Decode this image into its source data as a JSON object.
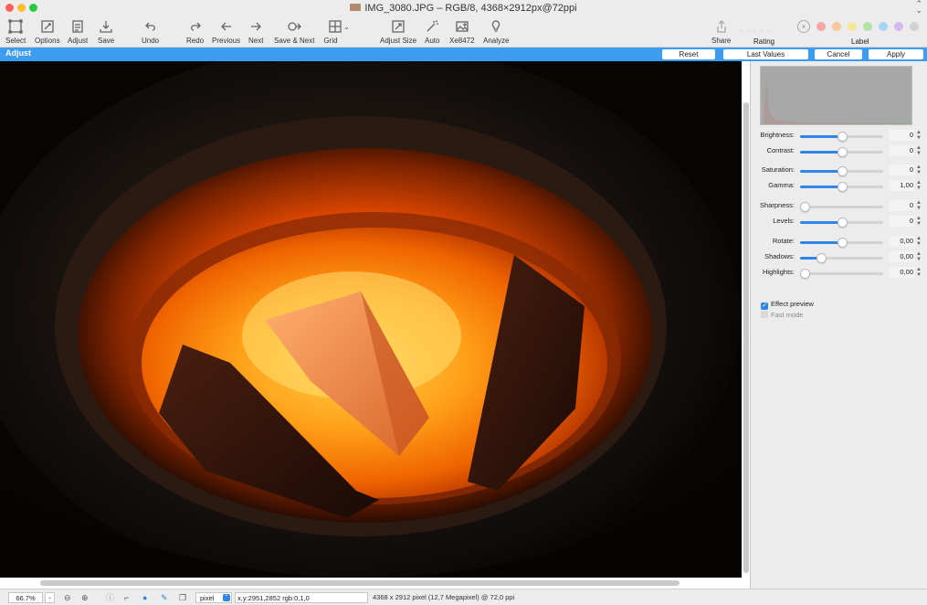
{
  "window": {
    "title": "IMG_3080.JPG – RGB/8, 4368×2912px@72ppi"
  },
  "toolbar": {
    "select": "Select",
    "options": "Options",
    "adjust": "Adjust",
    "save": "Save",
    "undo": "Undo",
    "redo": "Redo",
    "previous": "Previous",
    "next": "Next",
    "save_next": "Save & Next",
    "grid": "Grid",
    "adjust_size": "Adjust Size",
    "auto": "Auto",
    "xe": "Xe8472",
    "analyze": "Analyze",
    "share": "Share",
    "rating": "Rating",
    "label": "Label",
    "label_colors": [
      "#f7a6a6",
      "#f8c89c",
      "#f4e79a",
      "#b5e3a6",
      "#a8d4f5",
      "#d9b9f0",
      "#d2d2d2"
    ]
  },
  "adjust_bar": {
    "title": "Adjust",
    "reset": "Reset",
    "last_values": "Last Values",
    "cancel": "Cancel",
    "apply": "Apply"
  },
  "panel": {
    "sliders": [
      {
        "label": "Brightness:",
        "value": "0",
        "position": 0.5
      },
      {
        "label": "Contrast:",
        "value": "0",
        "position": 0.5
      },
      {
        "label": "Saturation:",
        "value": "0",
        "position": 0.5
      },
      {
        "label": "Gamma:",
        "value": "1,00",
        "position": 0.5
      },
      {
        "label": "Sharpness:",
        "value": "0",
        "position": 0.0
      },
      {
        "label": "Levels:",
        "value": "0",
        "position": 0.5
      },
      {
        "label": "Rotate:",
        "value": "0,00",
        "position": 0.5
      },
      {
        "label": "Shadows:",
        "value": "0,00",
        "position": 0.25
      },
      {
        "label": "Highlights:",
        "value": "0,00",
        "position": 0.0
      }
    ],
    "effect_preview": "Effect preview",
    "fast_mode": "Fast mode"
  },
  "status": {
    "zoom": "66.7%",
    "unit": "pixel",
    "coords": "x,y:2951,2852 rgb:0,1,0",
    "size_info": "4368 x 2912 pixel (12,7 Megapixel) @ 72,0 ppi"
  }
}
